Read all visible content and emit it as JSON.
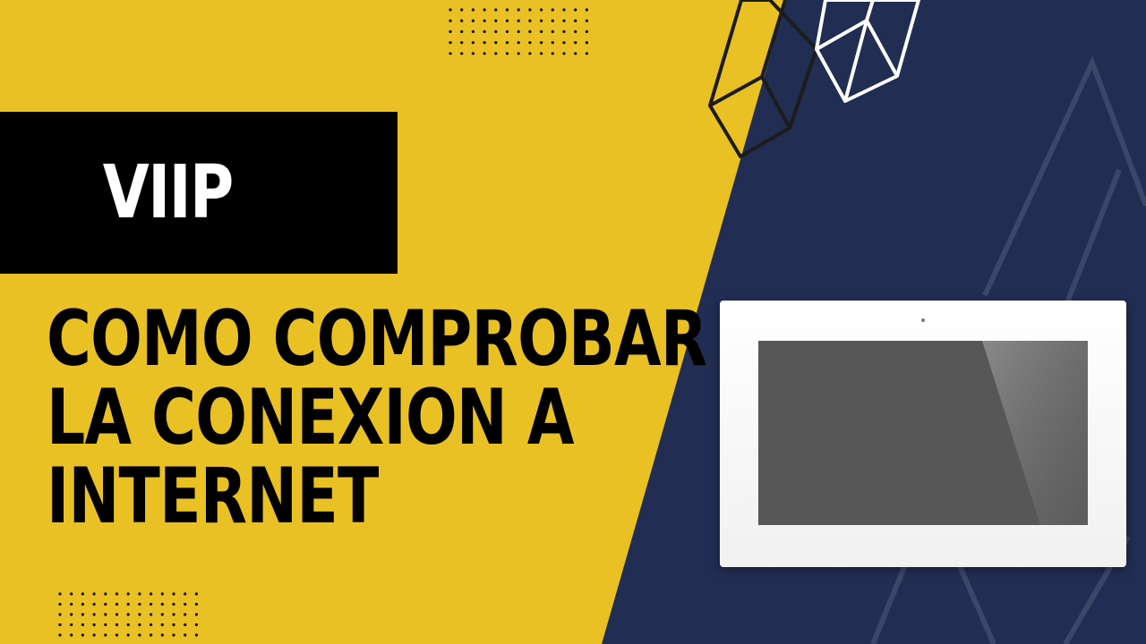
{
  "brand": {
    "name": "VIIP"
  },
  "headline": {
    "lines": [
      "COMO COMPROBAR",
      "LA CONEXION A",
      "INTERNET"
    ]
  },
  "icons": {
    "dots_top": "dot-grid-icon",
    "dots_bottom": "dot-grid-icon",
    "wireframe_dark": "wireframe-prism-icon",
    "wireframe_light": "wireframe-prism-icon",
    "device": "video-intercom-monitor-icon"
  },
  "colors": {
    "yellow": "#e9c124",
    "navy": "#212d52",
    "black": "#000000",
    "white": "#ffffff",
    "screen": "#575757"
  }
}
